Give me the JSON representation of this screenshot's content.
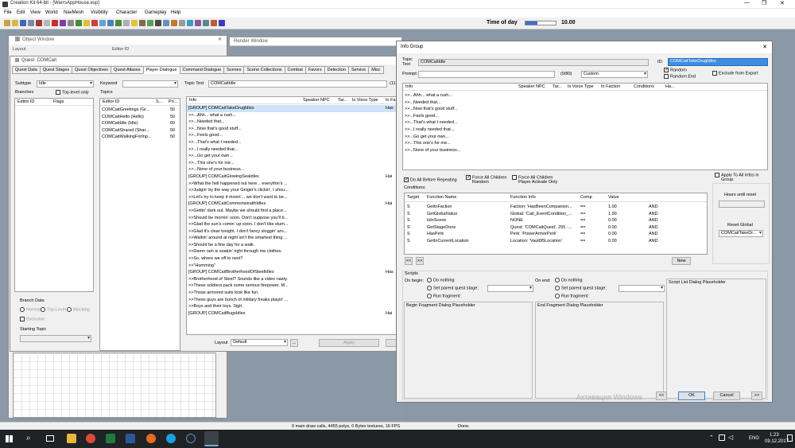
{
  "app": {
    "title": "Creation Kit 64-bit - [WerrsAppHouse.esp]",
    "menu": [
      "File",
      "Edit",
      "View",
      "World",
      "NavMesh",
      "Visibility",
      "Character",
      "Gameplay",
      "Help"
    ],
    "time_of_day_label": "Time of day",
    "time_of_day_value": "10.00",
    "time_of_day_fraction": 0.4
  },
  "object_window": {
    "title": "Object Window",
    "partial_labels": [
      "Layout",
      "Editor ID"
    ]
  },
  "render_window": {
    "title": "Render Window"
  },
  "quest": {
    "title": "Quest: COMCait",
    "tabs": [
      "Quest Data",
      "Quest Stages",
      "Quest Objectives",
      "Quest Aliases",
      "Player Dialogue",
      "Command Dialogue",
      "Scenes",
      "Scene Collections",
      "Combat",
      "Favors",
      "Detection",
      "Service",
      "Misc"
    ],
    "subtype_label": "Subtype",
    "subtype_value": "Idle",
    "keyword_label": "Keyword",
    "topic_text_label": "Topic Text",
    "topic_text_value": "COMCaitIdle",
    "topic_text_count": "(11",
    "branches_label": "Branches",
    "top_level_only": "Top-level only",
    "topics_label": "Topics",
    "branches_cols": [
      "Editor ID",
      "Flags"
    ],
    "topics_cols": [
      "Editor ID",
      "S...",
      "Pri..."
    ],
    "topics": [
      [
        "COMCaitGreetings (Gr...",
        "50"
      ],
      [
        "COMCaitHello (Hello)",
        "50"
      ],
      [
        "COMCaitIdle (Idle)",
        "60"
      ],
      [
        "COMCaitShared (Shar...",
        "50"
      ],
      [
        "COMCaitWalkingForInp...",
        "50"
      ]
    ],
    "branch_data_label": "Branch Data",
    "branch_normal": "Normal",
    "branch_toplevel": "Top-Level",
    "branch_blocking": "Blocking",
    "exclusive_label": "Exclusive",
    "starting_topic_label": "Starting Topic",
    "info_cols": [
      "Info",
      "Speaker NPC",
      "Tar...",
      "Is Voice Type",
      "In Fa"
    ],
    "info_rows": [
      [
        "[GROUP] COMCaitTakeDrugIdles",
        "Has"
      ],
      [
        ">>...Ahh... what a rush...",
        ""
      ],
      [
        ">>...Needed that...",
        ""
      ],
      [
        ">>...Now that's good stuff...",
        ""
      ],
      [
        ">>...Feels good...",
        ""
      ],
      [
        ">>...That's what I needed...",
        ""
      ],
      [
        ">>...I really needed that...",
        ""
      ],
      [
        ">>...Go get your own...",
        ""
      ],
      [
        ">>...This one's for me...",
        ""
      ],
      [
        ">>...None of your business...",
        ""
      ],
      [
        "[GROUP] COMCaitGlowingSeaIdles",
        "Hai"
      ],
      [
        ">>What the hell happened out here... everythin's ...",
        ""
      ],
      [
        ">>Judgin' by the way your Geiger's clickin', I shou...",
        ""
      ],
      [
        ">>Let's try to keep it movin'... we don't want to be...",
        ""
      ],
      [
        "[GROUP] COMCaitCommonwealthIdles",
        "Hai"
      ],
      [
        ">>Gettin' dark out. Maybe we should find a place...",
        ""
      ],
      [
        ">>Should be mornin' soon. Don't suppose you'll b...",
        ""
      ],
      [
        ">>Glad the sun's comin' up soon. I don't like stum...",
        ""
      ],
      [
        ">>Glad it's clear tonight. I don't fancy sloggin' aro...",
        ""
      ],
      [
        ">>Walkin' around at night isn't the smartest thing ...",
        ""
      ],
      [
        ">>Should be a fine day for a walk.",
        ""
      ],
      [
        ">>Damn rain is soakin' right through me clothes.",
        ""
      ],
      [
        ">>So, where we off to next?",
        ""
      ],
      [
        ">>\"Humming\"",
        ""
      ],
      [
        "[GROUP] COMCaitBrotherhoodOfSteelIdles",
        "Has"
      ],
      [
        ">>Brotherhood of Steel? Sounds like a video nasty.",
        ""
      ],
      [
        ">>These soldiers pack some serious firepower. M...",
        ""
      ],
      [
        ">>Those armored suits look like fun.",
        ""
      ],
      [
        ">>These guys are bunch of military freaks playin' ...",
        ""
      ],
      [
        ">>Boys and their toys. Sigh.",
        ""
      ],
      [
        "[GROUP] COMCaitBugsIdles",
        "Hai"
      ]
    ],
    "layout_label": "Layout",
    "layout_value": "Default",
    "apply_label": "Apply",
    "more_btn": "..."
  },
  "info_group": {
    "title": "Info Group",
    "topic_text_label1": "Topic",
    "topic_text_label2": "Text",
    "topic_text_value": "COMCaitIdle",
    "id_label": "ID:",
    "id_value": "COMCaitTakeDrugIdles",
    "prompt_label": "Prompt:",
    "prompt_count": "(0/80)",
    "prompt_type": "Custom",
    "random": "Random",
    "random_end": "Random End",
    "exclude_export": "Exclude from Export",
    "cols": [
      "Info",
      "Speaker NPC",
      "Tar...",
      "Is Voice Type",
      "In Faction",
      "Conditions",
      "Ha..."
    ],
    "rows": [
      ">>...Ahh... what a rush...",
      ">>...Needed that...",
      ">>...Now that's good stuff...",
      ">>...Feels good...",
      ">>...That's what I needed...",
      ">>...I really needed that...",
      ">>...Go get your own...",
      ">>...This one's for me...",
      ">>...None of your business..."
    ],
    "do_all_before": "Do All Before Repeating",
    "force_random_1": "Force All Children",
    "force_random_2": "Random",
    "force_activate_1": "Force All Children",
    "force_activate_2": "Player Activate Only",
    "apply_all_1": "Apply To All Infos in",
    "apply_all_2": "Group",
    "hours_reset": "Hours until reset",
    "reset_global": "Reset Global",
    "reset_global_value": "COMCaitTakeDr...",
    "conditions_label": "Conditions:",
    "cond_cols": [
      "Target",
      "Function Name",
      "Function Info",
      "Comp",
      "Value",
      ""
    ],
    "conditions": [
      [
        "S",
        "GetInFaction",
        "Faction: 'HasBeenCompanion...",
        "==",
        "1.00",
        "AND"
      ],
      [
        "S",
        "GetGlobalValue",
        "Global: 'Cait_EventCondition_...",
        "==",
        "1.00",
        "AND"
      ],
      [
        "S",
        "IsInScene",
        "NONE",
        "==",
        "0.00",
        "AND"
      ],
      [
        "S",
        "GetStageDone",
        "Quest: 'COMCaitQuest', 255 -...",
        "==",
        "0.00",
        "AND"
      ],
      [
        "S",
        "HasPerk",
        "Perk: 'PowerArmorPerk'",
        "==",
        "0.00",
        "AND"
      ],
      [
        "S",
        "GetInCurrentLocation",
        "Location: 'Vault95Location'",
        "==",
        "0.00",
        "AND"
      ]
    ],
    "prev_btn": "<<",
    "next_btn": ">>",
    "new_btn": "New",
    "scripts_label": "Scripts",
    "on_begin": "On begin:",
    "on_end": "On end:",
    "do_nothing": "Do nothing",
    "set_parent": "Set parent quest stage:",
    "run_fragment": "Run fragment:",
    "begin_fragment": "Begin Fragment Dialog Placeholder",
    "end_fragment": "End Fragment Dialog Placeholder",
    "script_list": "Script List Dialog Placeholder",
    "ok": "OK",
    "cancel": "Cancel",
    "watermark": "Активация Windows"
  },
  "status": {
    "draw_calls": "0 main draw calls, 4455 polys, 0 Bytex textures, 16 FPS",
    "state": "Done."
  },
  "taskbar": {
    "lang": "ENG",
    "time": "1:23",
    "date": "09.12.2017"
  }
}
